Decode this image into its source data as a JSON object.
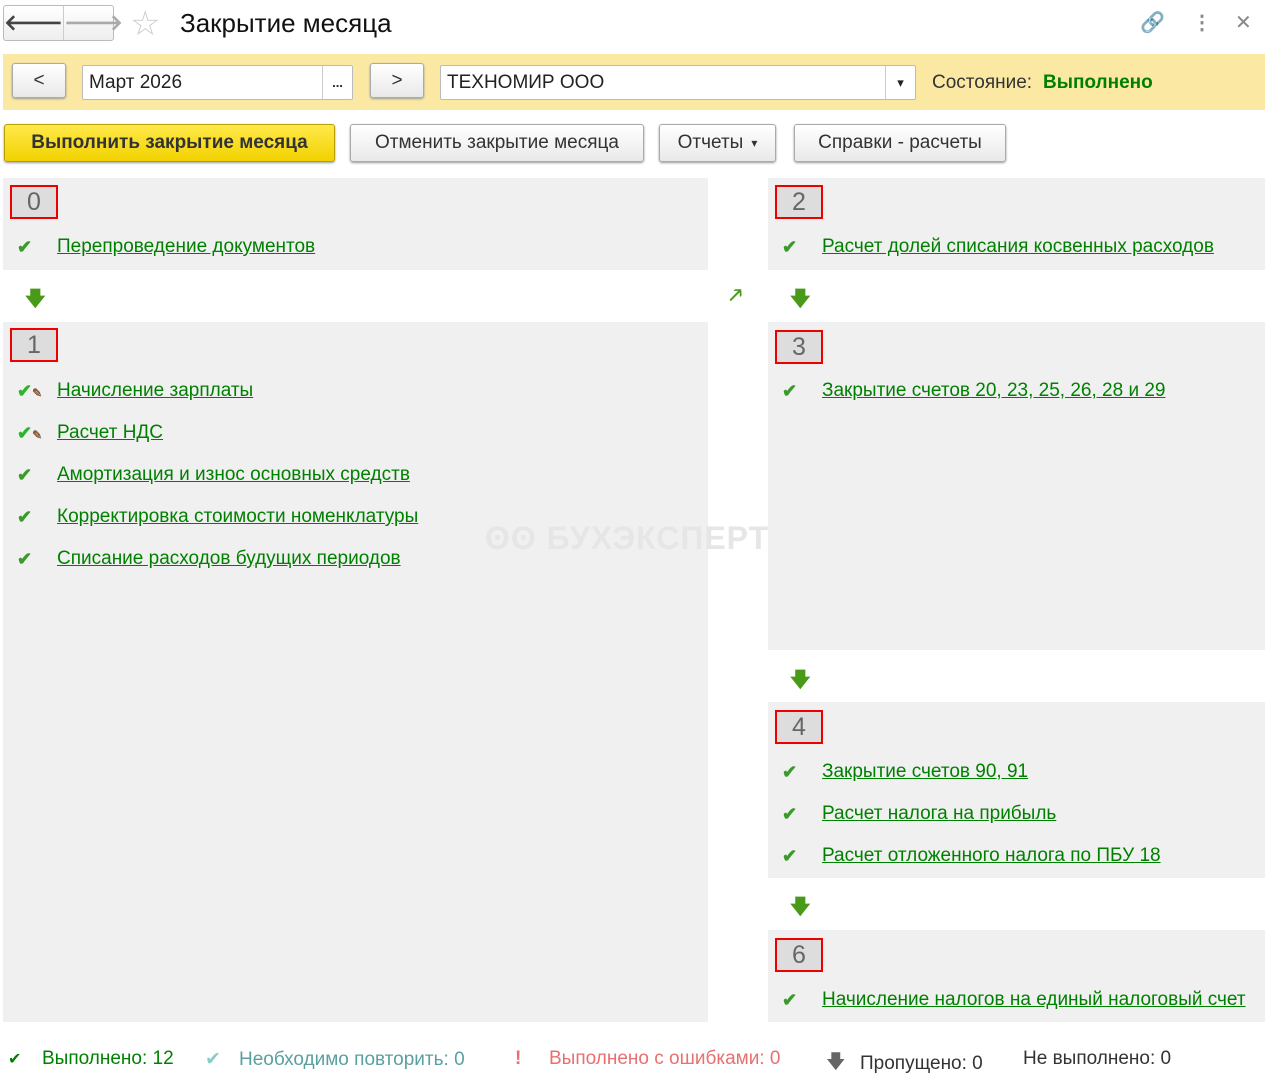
{
  "window": {
    "title": "Закрытие месяца"
  },
  "toolbar": {
    "prev": "<",
    "period": "Март 2026",
    "period_select": "...",
    "next": ">",
    "organization": "ТЕХНОМИР ООО",
    "state_label": "Состояние:",
    "state_value": "Выполнено"
  },
  "actions": {
    "run": "Выполнить закрытие месяца",
    "cancel": "Отменить закрытие месяца",
    "reports": "Отчеты",
    "references": "Справки - расчеты"
  },
  "watermark": "БУХЭКСПЕРТ",
  "sections": {
    "s0": {
      "num": "0",
      "items": [
        "Перепроведение документов"
      ]
    },
    "s1": {
      "num": "1",
      "items": [
        "Начисление зарплаты",
        "Расчет НДС",
        "Амортизация и износ основных средств",
        "Корректировка стоимости номенклатуры",
        "Списание расходов будущих периодов"
      ]
    },
    "s2": {
      "num": "2",
      "items": [
        "Расчет долей списания косвенных расходов"
      ]
    },
    "s3": {
      "num": "3",
      "items": [
        "Закрытие счетов 20, 23, 25, 26, 28 и 29"
      ]
    },
    "s4": {
      "num": "4",
      "items": [
        "Закрытие счетов 90, 91",
        "Расчет налога на прибыль",
        "Расчет отложенного налога по ПБУ 18"
      ]
    },
    "s6": {
      "num": "6",
      "items": [
        "Начисление налогов на единый налоговый счет"
      ]
    }
  },
  "statusbar": {
    "done": "Выполнено: 12",
    "repeat": "Необходимо повторить: 0",
    "errors": "Выполнено с ошибками: 0",
    "skipped": "Пропущено: 0",
    "not_done": "Не выполнено: 0"
  },
  "colors": {
    "link": "#008000",
    "accent": "#f5d800",
    "error": "#e87070",
    "repeat": "#5aa0a0"
  }
}
